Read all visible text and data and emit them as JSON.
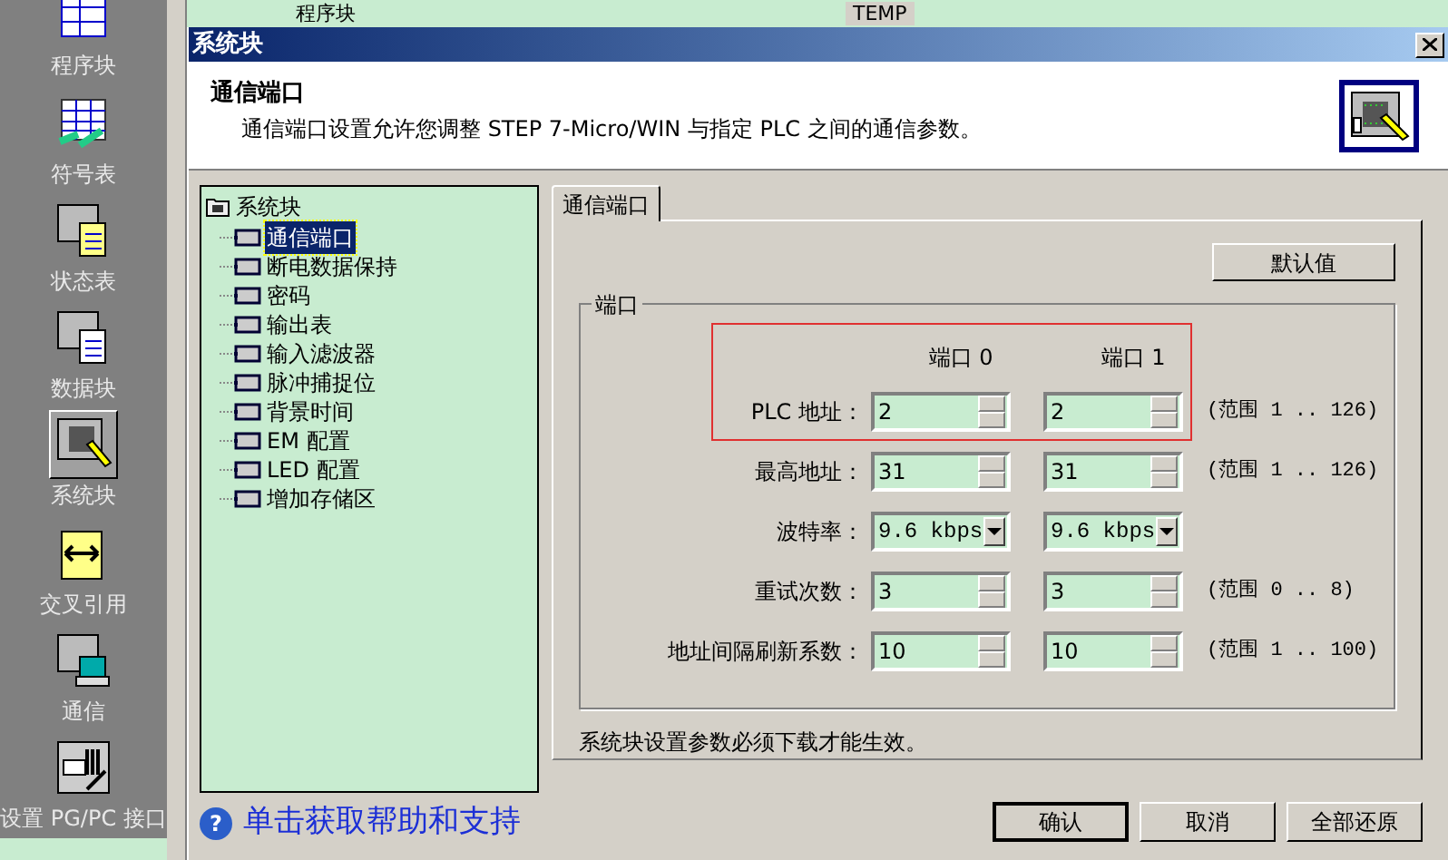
{
  "sidebar": {
    "items": [
      {
        "label": "程序块",
        "selected": false
      },
      {
        "label": "符号表",
        "selected": false
      },
      {
        "label": "状态表",
        "selected": false
      },
      {
        "label": "数据块",
        "selected": false
      },
      {
        "label": "系统块",
        "selected": true
      },
      {
        "label": "交叉引用",
        "selected": false
      },
      {
        "label": "通信",
        "selected": false
      },
      {
        "label": "设置 PG/PC 接口",
        "selected": false
      }
    ]
  },
  "background": {
    "tree_item": "程序块",
    "cell": "TEMP"
  },
  "dialog": {
    "title": "系统块",
    "header": {
      "title": "通信端口",
      "description": "通信端口设置允许您调整 STEP 7-Micro/WIN 与指定 PLC 之间的通信参数。"
    },
    "tree": {
      "root": "系统块",
      "items": [
        {
          "label": "通信端口",
          "selected": true
        },
        {
          "label": "断电数据保持",
          "selected": false
        },
        {
          "label": "密码",
          "selected": false
        },
        {
          "label": "输出表",
          "selected": false
        },
        {
          "label": "输入滤波器",
          "selected": false
        },
        {
          "label": "脉冲捕捉位",
          "selected": false
        },
        {
          "label": "背景时间",
          "selected": false
        },
        {
          "label": "EM 配置",
          "selected": false
        },
        {
          "label": "LED 配置",
          "selected": false
        },
        {
          "label": "增加存储区",
          "selected": false
        }
      ]
    },
    "tabs": [
      {
        "label": "通信端口",
        "selected": true
      }
    ],
    "default_button": "默认值",
    "group": {
      "title": "端口",
      "columns": [
        "端口 0",
        "端口 1"
      ],
      "rows": [
        {
          "label": "PLC 地址：",
          "kind": "spin",
          "values": [
            "2",
            "2"
          ],
          "range": "(范围 1 .. 126)",
          "highlighted": true
        },
        {
          "label": "最高地址：",
          "kind": "spin",
          "values": [
            "31",
            "31"
          ],
          "range": "(范围 1 .. 126)",
          "highlighted": false
        },
        {
          "label": "波特率：",
          "kind": "dropdown",
          "values": [
            "9.6 kbps",
            "9.6 kbps"
          ],
          "highlighted": false
        },
        {
          "label": "重试次数：",
          "kind": "spin",
          "values": [
            "3",
            "3"
          ],
          "range": "(范围 0 .. 8)",
          "highlighted": false
        },
        {
          "label": "地址间隔刷新系数：",
          "kind": "spin",
          "values": [
            "10",
            "10"
          ],
          "range": "(范围 1 .. 100)",
          "highlighted": false
        }
      ]
    },
    "note": "系统块设置参数必须下载才能生效。",
    "help_icon": "?",
    "help_link": "单击获取帮助和支持",
    "buttons": [
      {
        "label": "确认",
        "default": true
      },
      {
        "label": "取消",
        "default": false
      },
      {
        "label": "全部还原",
        "default": false
      }
    ]
  }
}
